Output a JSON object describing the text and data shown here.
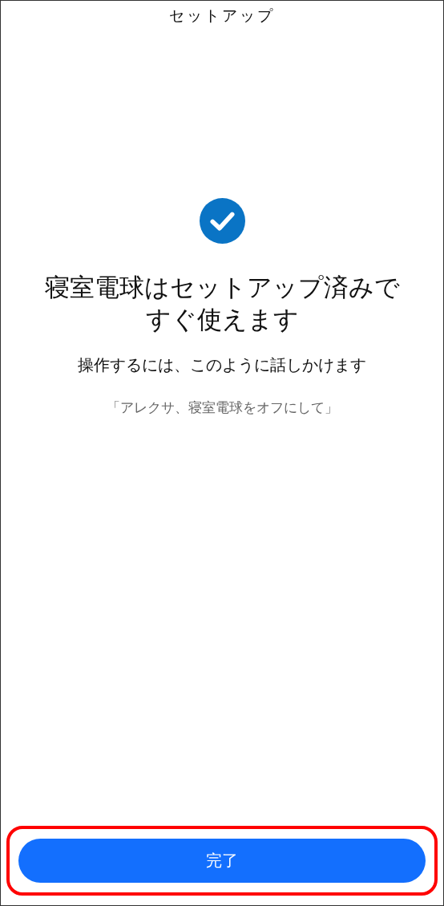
{
  "header": {
    "title": "セットアップ"
  },
  "status": {
    "kind": "success"
  },
  "heading": "寝室電球はセットアップ済みですぐ使えます",
  "instruction": "操作するには、このように話しかけます",
  "example_phrase": "「アレクサ、寝室電球をオフにして」",
  "done_button": {
    "label": "完了",
    "highlighted": true
  }
}
